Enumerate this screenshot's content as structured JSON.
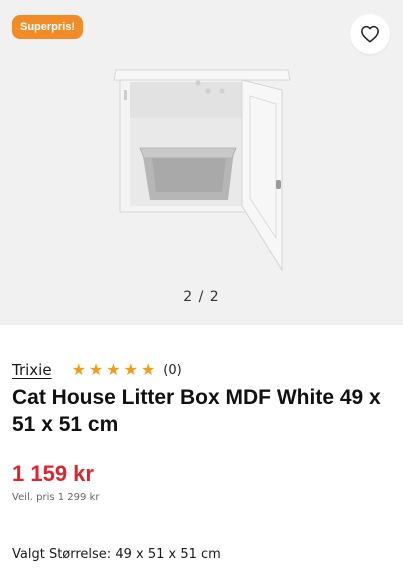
{
  "gallery": {
    "badge": "Superpris!",
    "pager": "2 / 2",
    "current_image": 2,
    "total_images": 2
  },
  "product": {
    "brand": "Trixie",
    "rating": 5,
    "rating_count": "(0)",
    "title": "Cat House Litter Box MDF White 49 x 51 x 51 cm",
    "price": "1 159 kr",
    "regular_price": "Veil. pris 1 299 kr",
    "size_label": "Valgt Størrelse: 49 x 51 x 51 cm"
  },
  "colors": {
    "badge": "#f28c28",
    "price": "#e0242e",
    "star": "#f39c1a",
    "gallery_bg": "#f1f1f1"
  },
  "icons": {
    "favorite": "heart-outline-icon",
    "rating": "star-icon"
  }
}
